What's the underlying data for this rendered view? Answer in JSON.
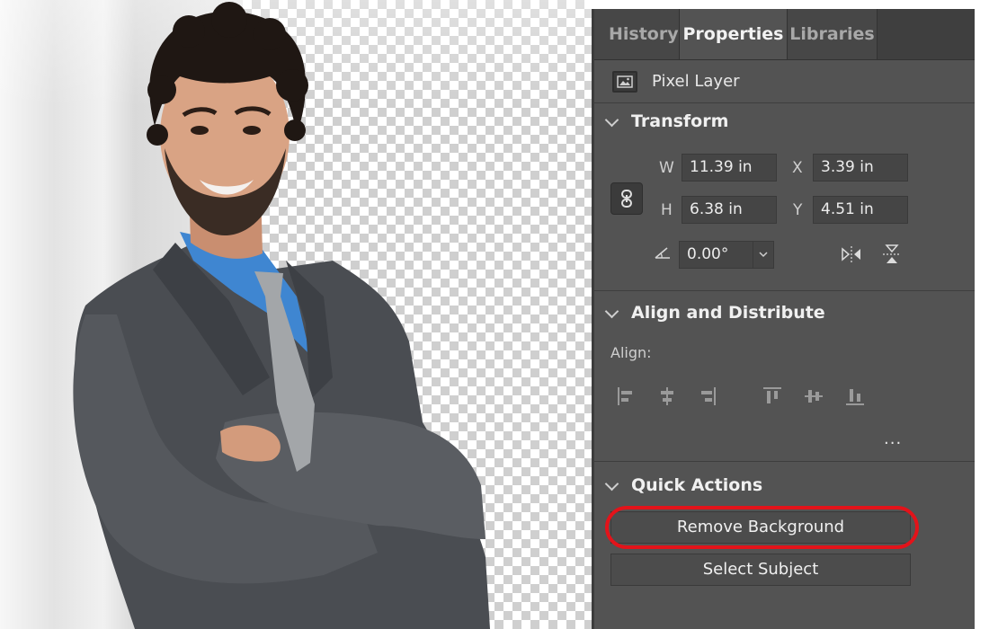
{
  "panel": {
    "tabs": [
      {
        "label": "History",
        "active": false
      },
      {
        "label": "Properties",
        "active": true
      },
      {
        "label": "Libraries",
        "active": false
      }
    ],
    "layer_type": "Pixel Layer",
    "layer_icon": "image-icon",
    "transform": {
      "title": "Transform",
      "w_label": "W",
      "w_value": "11.39 in",
      "h_label": "H",
      "h_value": "6.38 in",
      "x_label": "X",
      "x_value": "3.39 in",
      "y_label": "Y",
      "y_value": "4.51 in",
      "angle_value": "0.00°",
      "link_icon": "link-icon",
      "angle_icon": "angle-icon",
      "flip_h_icon": "flip-horizontal-icon",
      "flip_v_icon": "flip-vertical-icon"
    },
    "align": {
      "title": "Align and Distribute",
      "label": "Align:",
      "more": "..."
    },
    "quick_actions": {
      "title": "Quick Actions",
      "remove_bg": "Remove Background",
      "select_subject": "Select Subject"
    }
  },
  "colors": {
    "panel_bg": "#535353",
    "highlight": "#e3131a"
  }
}
